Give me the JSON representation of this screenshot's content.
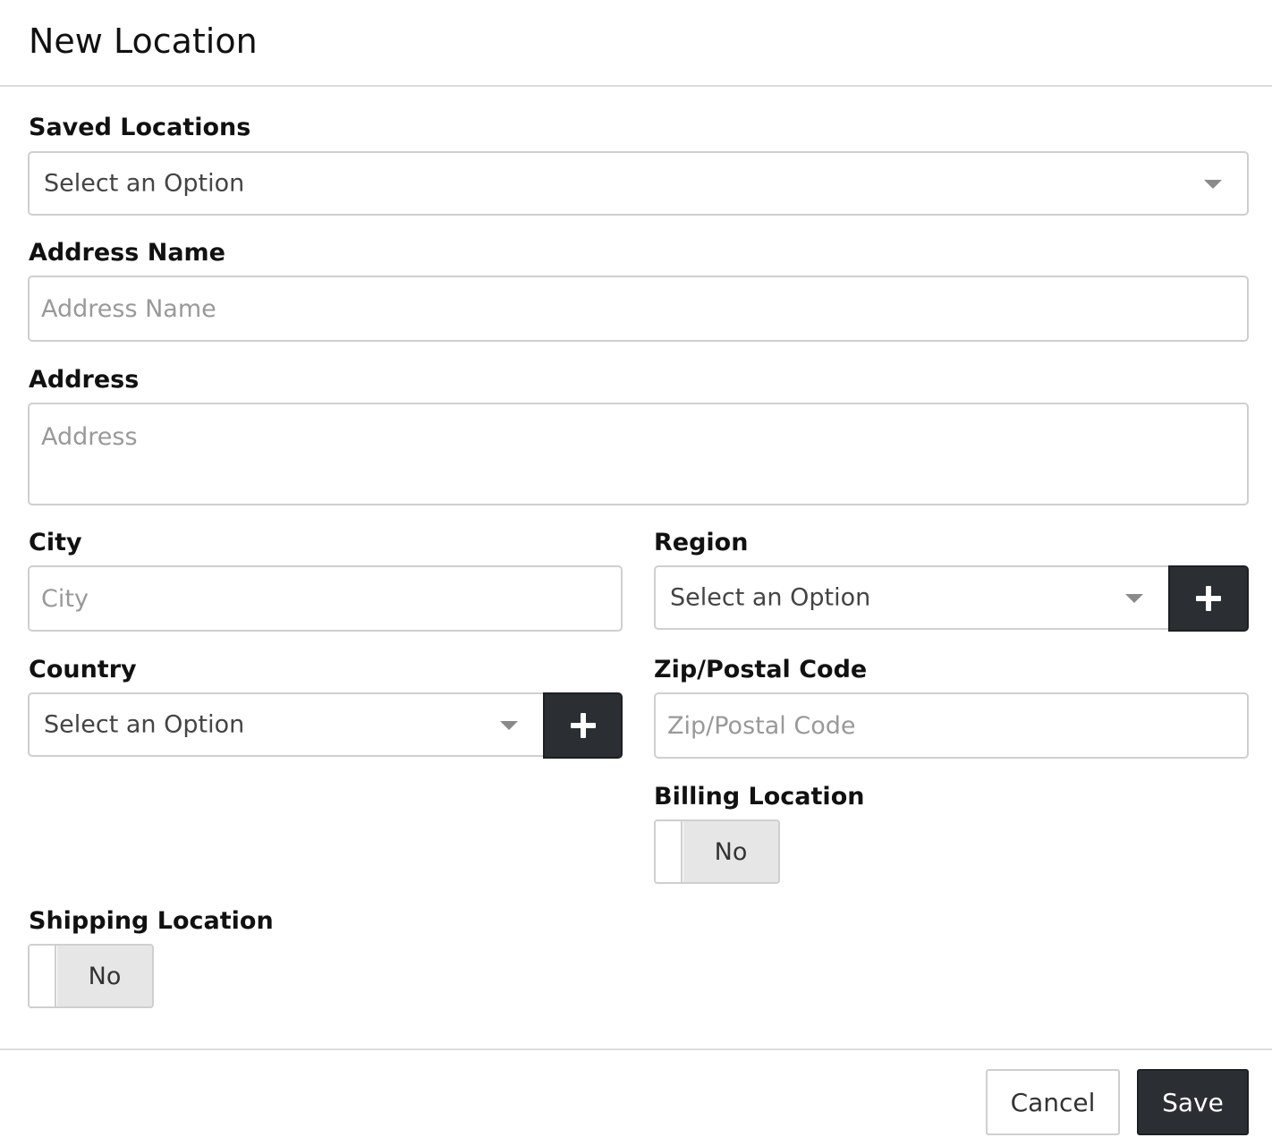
{
  "modal": {
    "title": "New Location"
  },
  "form": {
    "saved_locations": {
      "label": "Saved Locations",
      "value": "Select an Option"
    },
    "address_name": {
      "label": "Address Name",
      "placeholder": "Address Name",
      "value": ""
    },
    "address": {
      "label": "Address",
      "placeholder": "Address",
      "value": ""
    },
    "city": {
      "label": "City",
      "placeholder": "City",
      "value": ""
    },
    "region": {
      "label": "Region",
      "value": "Select an Option",
      "add_icon": "plus-icon"
    },
    "country": {
      "label": "Country",
      "value": "Select an Option",
      "add_icon": "plus-icon"
    },
    "zip": {
      "label": "Zip/Postal Code",
      "placeholder": "Zip/Postal Code",
      "value": ""
    },
    "billing_location": {
      "label": "Billing Location",
      "state": "No"
    },
    "shipping_location": {
      "label": "Shipping Location",
      "state": "No"
    }
  },
  "footer": {
    "cancel_label": "Cancel",
    "save_label": "Save"
  },
  "colors": {
    "primary_button": "#2b2f33",
    "border": "#cfcfcf",
    "toggle_off": "#e6e6e6"
  }
}
